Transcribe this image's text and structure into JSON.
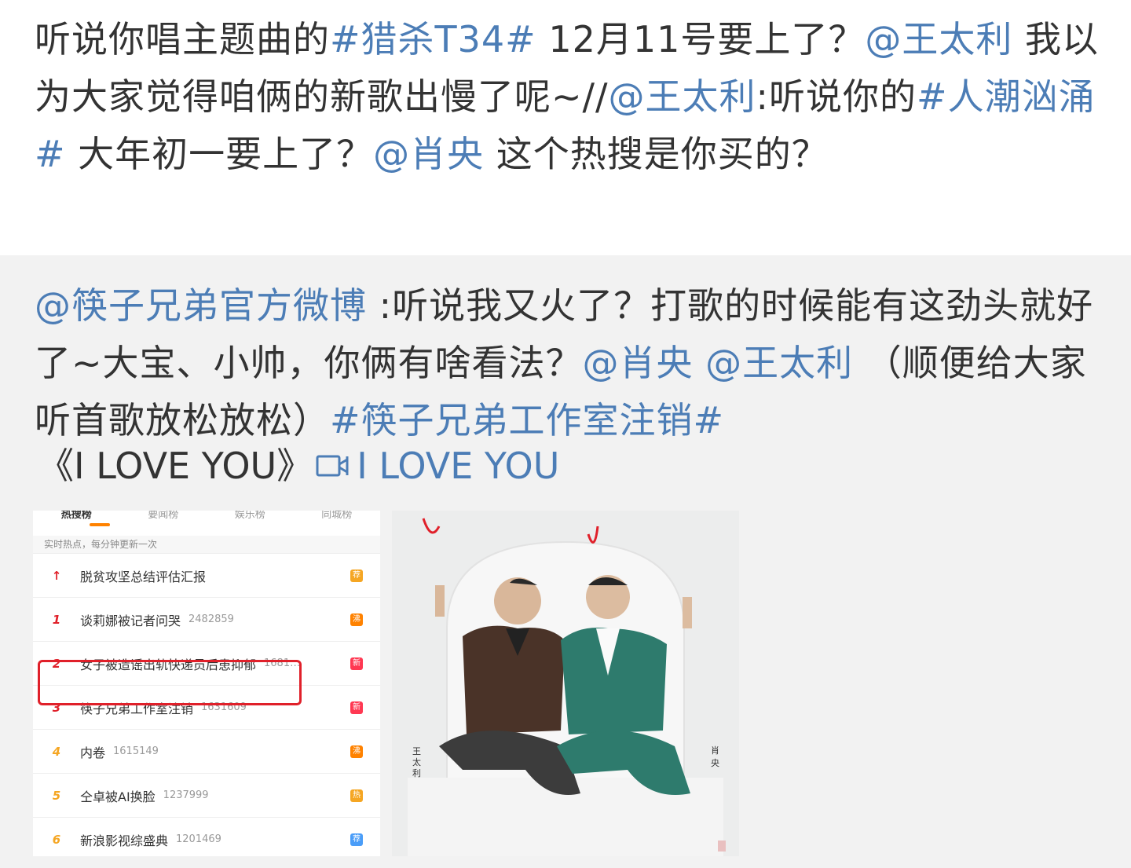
{
  "post": {
    "segments": [
      {
        "t": "听说你唱主题曲的",
        "link": false
      },
      {
        "t": "#猎杀T34#",
        "link": true
      },
      {
        "t": " 12月11号要上了？",
        "link": false
      },
      {
        "t": "@王太利",
        "link": true
      },
      {
        "t": " 我以为大家觉得咱俩的新歌出慢了呢~//",
        "link": false
      },
      {
        "t": "@王太利",
        "link": true
      },
      {
        "t": ":听说你的",
        "link": false
      },
      {
        "t": "#人潮汹涌#",
        "link": true
      },
      {
        "t": " 大年初一要上了？",
        "link": false
      },
      {
        "t": "@肖央",
        "link": true
      },
      {
        "t": "  这个热搜是你买的？",
        "link": false
      }
    ]
  },
  "repost": {
    "segments": [
      {
        "t": "@筷子兄弟官方微博",
        "link": true
      },
      {
        "t": " :听说我又火了？打歌的时候能有这劲头就好了~大宝、小帅，你俩有啥看法？",
        "link": false
      },
      {
        "t": "@肖央",
        "link": true
      },
      {
        "t": " ",
        "link": false
      },
      {
        "t": "@王太利",
        "link": true
      },
      {
        "t": " （顺便给大家听首歌放松放松）",
        "link": false
      },
      {
        "t": "#筷子兄弟工作室注销#",
        "link": true
      }
    ],
    "song_title": "《I LOVE YOU》",
    "video_link_label": "I LOVE YOU"
  },
  "hot_search": {
    "tabs": [
      "热搜榜",
      "要闻榜",
      "娱乐榜",
      "同城榜"
    ],
    "subheader": "实时热点，每分钟更新一次",
    "rows": [
      {
        "rank": "↑",
        "title": "脱贫攻坚总结评估汇报",
        "count": "",
        "tag": "荐",
        "rank_color": "#e0202a",
        "tag_color": "#f5a623"
      },
      {
        "rank": "1",
        "title": "谈莉娜被记者问哭",
        "count": "2482859",
        "tag": "沸",
        "rank_color": "#e0202a",
        "tag_color": "#ff8200"
      },
      {
        "rank": "2",
        "title": "女子被造谣出轨快递员后患抑郁",
        "count": "1681…",
        "tag": "新",
        "rank_color": "#e0202a",
        "tag_color": "#ff3852"
      },
      {
        "rank": "3",
        "title": "筷子兄弟工作室注销",
        "count": "1631609",
        "tag": "新",
        "rank_color": "#e0202a",
        "tag_color": "#ff3852"
      },
      {
        "rank": "4",
        "title": "内卷",
        "count": "1615149",
        "tag": "沸",
        "rank_color": "#f5a623",
        "tag_color": "#ff8200"
      },
      {
        "rank": "5",
        "title": "仝卓被AI换脸",
        "count": "1237999",
        "tag": "热",
        "rank_color": "#f5a623",
        "tag_color": "#f5a623"
      },
      {
        "rank": "6",
        "title": "新浪影视综盛典",
        "count": "1201469",
        "tag": "荐",
        "rank_color": "#f5a623",
        "tag_color": "#4a9df8"
      }
    ]
  },
  "photo": {
    "name_left": "王太利",
    "name_right": "肖央"
  },
  "colors": {
    "link": "#4c7db6",
    "highlight_box": "#e0202a"
  }
}
